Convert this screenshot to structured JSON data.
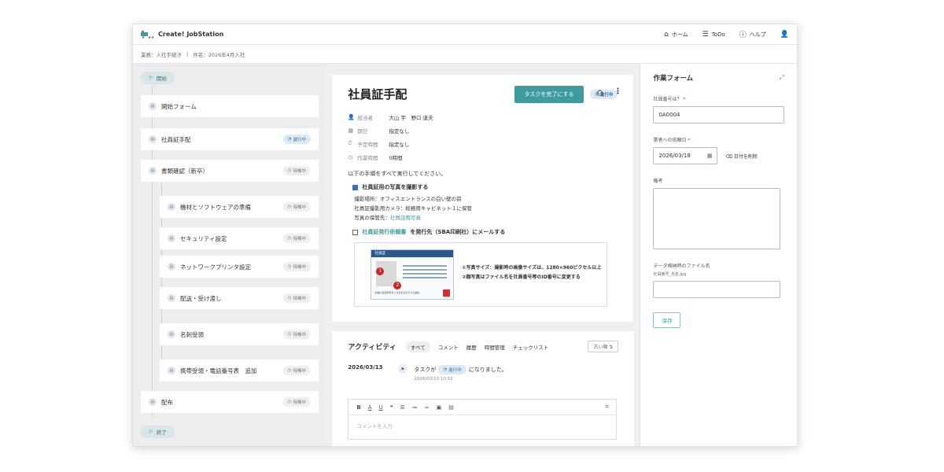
{
  "app": {
    "title": "Create! JobStation"
  },
  "nav": {
    "home": "ホーム",
    "todo": "ToDo",
    "help": "ヘルプ"
  },
  "breadcrumb": {
    "business": "業務：入社手続き",
    "case": "件名：2026年4月入社"
  },
  "flow": {
    "start": "開始",
    "end": "終了",
    "steps": [
      {
        "label": "開始フォーム",
        "status": ""
      },
      {
        "label": "社員証手配",
        "status": "進行中"
      },
      {
        "label": "書類確認（新卒）",
        "status": "待機中"
      },
      {
        "label": "機材とソフトウェアの準備",
        "status": "待機中"
      },
      {
        "label": "セキュリティ設定",
        "status": "待機中"
      },
      {
        "label": "ネットワークプリンタ設定",
        "status": "待機中"
      },
      {
        "label": "配送・受け渡し",
        "status": "待機中"
      },
      {
        "label": "名刺受領",
        "status": "待機中"
      },
      {
        "label": "携帯受領・電話番号表　追加",
        "status": "待機中"
      },
      {
        "label": "配布",
        "status": "待機中"
      }
    ]
  },
  "task": {
    "title": "社員証手配",
    "status": "進行中",
    "complete_button": "タスクを完了にする",
    "meta": [
      {
        "label": "担当者",
        "value": "大山 宇　野口 道夫"
      },
      {
        "label": "期日",
        "value": "指定なし"
      },
      {
        "label": "予定時間",
        "value": "指定なし"
      },
      {
        "label": "作業時間",
        "value": "0時間"
      }
    ],
    "instruction": "以下の手順をすべて実行してください。",
    "check1": "社員証用の写真を撮影する",
    "check1_lines": [
      "撮影場所：オフィスエントランスの白い壁の前",
      "社員証撮影用カメラ：総務用キャビネット１に保管"
    ],
    "photo_location_label": "写真の保管先：",
    "photo_location_link": "社員証用写真",
    "check2_link": "社員証発行依頼書",
    "check2_rest": "を発行先（SBA印刷社）にメールする",
    "card_label": "社員証",
    "card_note": "企業の最新顔写真と氏名を表示する社員証",
    "img_caption": [
      "①写真サイズ：撮影時の画像サイズは、1280×960ピクセル以上",
      "②顔写真はファイル名を社員番号等のID番号に変更する"
    ]
  },
  "activity": {
    "title": "アクティビティ",
    "tabs": [
      "すべて",
      "コメント",
      "履歴",
      "時間管理",
      "チェックリスト"
    ],
    "sort": "古い順",
    "date": "2026/03/13",
    "entry_prefix": "タスクが",
    "entry_status": "進行中",
    "entry_suffix": "になりました。",
    "entry_time": "2026/03/13 10:52",
    "comment_placeholder": "コメントを入力"
  },
  "form": {
    "title": "作業フォーム",
    "employee_no_label": "社員番号は？",
    "employee_no_value": "0A0004",
    "request_date_label": "業者への依頼日",
    "request_date_value": "2026/03/18",
    "clear_date": "日付を削除",
    "note_label": "備考",
    "file_label": "データ格納時のファイル名",
    "file_hint": "社員番号_氏名.jpg",
    "save_button": "保存"
  },
  "colors": {
    "accent": "#3f9ba1",
    "active_badge": "#dbeaf6"
  }
}
